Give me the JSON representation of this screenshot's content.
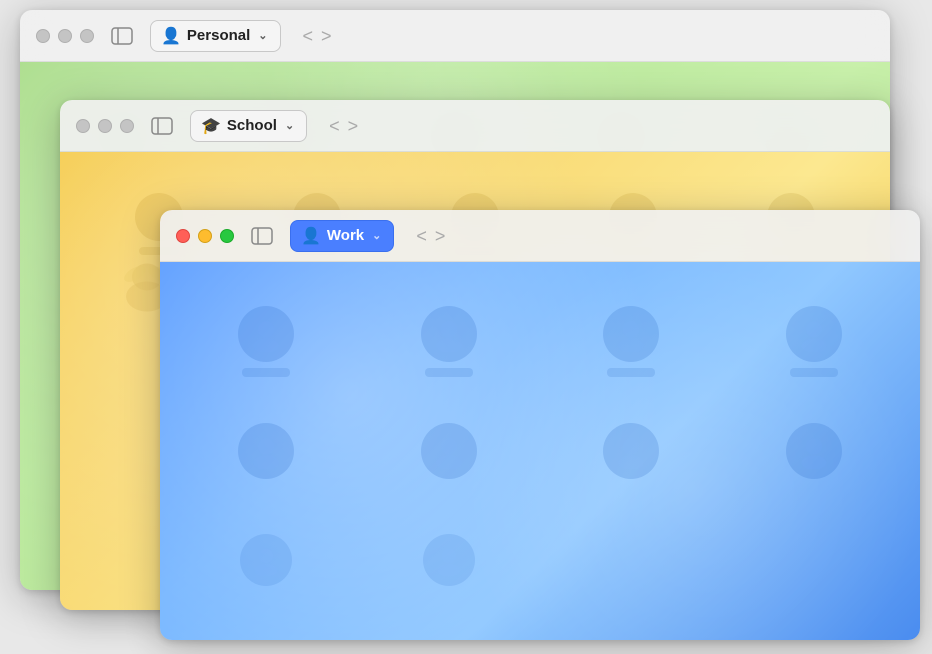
{
  "windows": {
    "personal": {
      "title": "Personal",
      "icon": "👤",
      "zIndex": 1,
      "pillActive": false,
      "trafficLights": "gray",
      "navBack": "<",
      "navForward": ">",
      "sidebarLabel": "Toggle Sidebar",
      "pillLabel": "Personal",
      "chevron": "∨"
    },
    "school": {
      "title": "School",
      "icon": "🎓",
      "zIndex": 2,
      "pillActive": false,
      "trafficLights": "gray",
      "navBack": "<",
      "navForward": ">",
      "sidebarLabel": "Toggle Sidebar",
      "pillLabel": "School",
      "chevron": "∨"
    },
    "work": {
      "title": "Work",
      "icon": "👤",
      "zIndex": 3,
      "pillActive": true,
      "trafficLights": "color",
      "navBack": "<",
      "navForward": ">",
      "sidebarLabel": "Toggle Sidebar",
      "pillLabel": "Work",
      "chevron": "∨"
    }
  }
}
